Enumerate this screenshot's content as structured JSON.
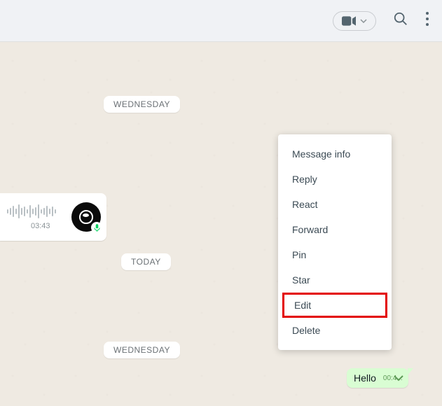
{
  "header": {
    "video_button": "video-call",
    "search_button": "search",
    "menu_button": "menu"
  },
  "chat": {
    "date_chips": [
      "WEDNESDAY",
      "TODAY",
      "WEDNESDAY"
    ],
    "voice_message": {
      "timestamp": "03:43"
    },
    "outgoing": {
      "text": "Hello",
      "timestamp": "00:4..."
    }
  },
  "context_menu": {
    "items": [
      {
        "label": "Message info",
        "highlighted": false
      },
      {
        "label": "Reply",
        "highlighted": false
      },
      {
        "label": "React",
        "highlighted": false
      },
      {
        "label": "Forward",
        "highlighted": false
      },
      {
        "label": "Pin",
        "highlighted": false
      },
      {
        "label": "Star",
        "highlighted": false
      },
      {
        "label": "Edit",
        "highlighted": true
      },
      {
        "label": "Delete",
        "highlighted": false
      }
    ]
  }
}
